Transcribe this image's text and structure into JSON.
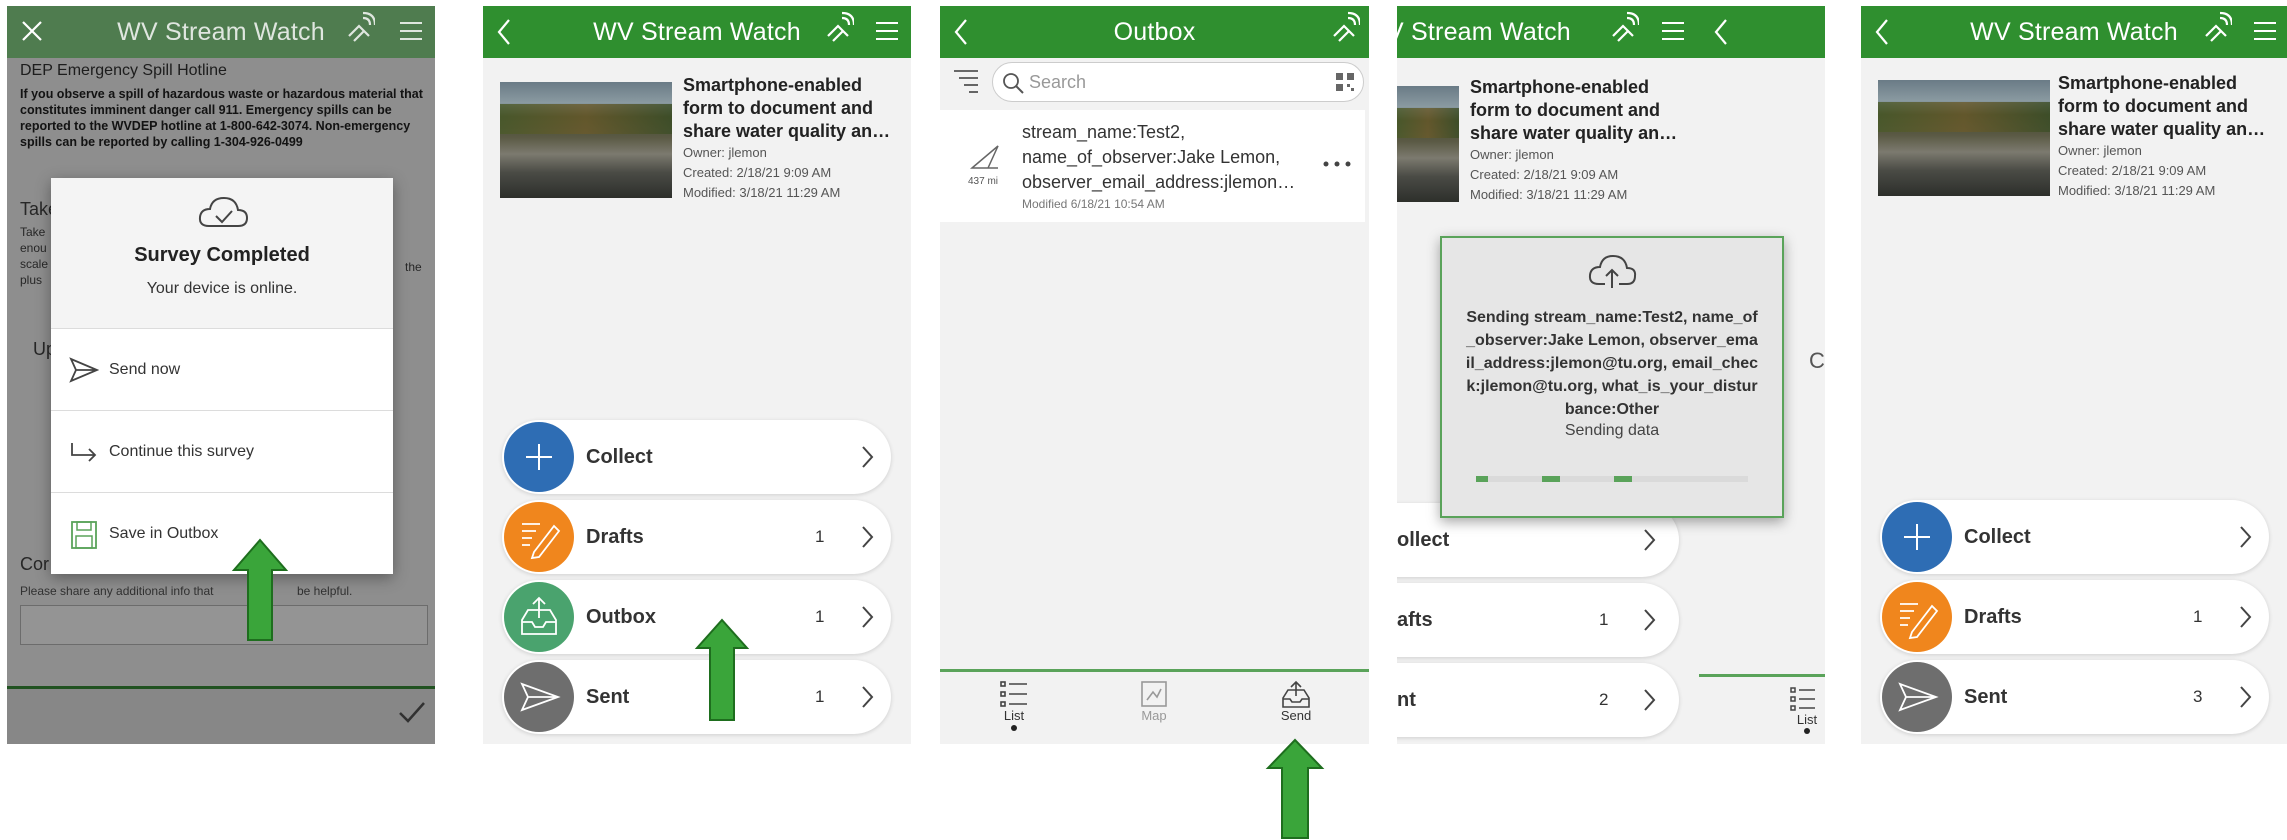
{
  "panel1": {
    "title": "WV Stream Watch",
    "section_heading": "DEP Emergency Spill Hotline",
    "hotline_text": "If you observe a spill of hazardous waste or hazardous material that constitutes imminent danger call 911. Emergency spills can be reported to the WVDEP hotline at 1-800-642-3074. Non-emergency spills can be reported by calling 1-304-926-0499",
    "partial_take": "Take",
    "partial_lines": [
      "Take",
      "enou",
      "scale",
      "plus"
    ],
    "partial_the": "the",
    "partial_up": "Up",
    "partial_comments": "Cor",
    "comments_hint": "Please share any additional info that",
    "comments_hint_tail": "be helpful.",
    "dialog": {
      "title": "Survey Completed",
      "subtitle": "Your device is online.",
      "options": [
        "Send now",
        "Continue this survey",
        "Save in Outbox"
      ]
    }
  },
  "panel2": {
    "title": "WV Stream Watch",
    "form_title": "Smartphone-enabled form to document and share water quality an…",
    "owner": "Owner: jlemon",
    "created": "Created: 2/18/21 9:09 AM",
    "modified": "Modified: 3/18/21 11:29 AM",
    "menu": [
      {
        "label": "Collect",
        "count": "",
        "color": "#2e6db4"
      },
      {
        "label": "Drafts",
        "count": "1",
        "color": "#f0861d"
      },
      {
        "label": "Outbox",
        "count": "1",
        "color": "#4aa36e"
      },
      {
        "label": "Sent",
        "count": "1",
        "color": "#6e6e6e"
      }
    ]
  },
  "panel3": {
    "title": "Outbox",
    "search_placeholder": "Search",
    "item": {
      "line1": "stream_name:Test2,",
      "line2": "name_of_observer:Jake Lemon,",
      "line3": "observer_email_address:jlemon…",
      "modified": "Modified 6/18/21 10:54 AM",
      "distance": "437 mi"
    },
    "tabs": [
      "List",
      "Map",
      "Send"
    ]
  },
  "panel4": {
    "title": "V Stream Watch",
    "form_title": "Smartphone-enabled form to document and share water quality an…",
    "owner": "Owner: jlemon",
    "created": "Created: 2/18/21 9:09 AM",
    "modified": "Modified: 3/18/21 11:29 AM",
    "sending_text": "Sending stream_name:Test2, name_of_observer:Jake Lemon, observer_email_address:jlemon@tu.org, email_check:jlemon@tu.org, what_is_your_disturbance:Other",
    "sending_status": "Sending data",
    "menu": [
      {
        "label": "ollect",
        "count": ""
      },
      {
        "label": "afts",
        "count": "1"
      },
      {
        "label": "nt",
        "count": "2"
      }
    ],
    "side_char": "C",
    "side_tab": "List"
  },
  "panel5": {
    "title": "WV Stream Watch",
    "form_title": "Smartphone-enabled form to document and share water quality an…",
    "owner": "Owner: jlemon",
    "created": "Created: 2/18/21 9:09 AM",
    "modified": "Modified: 3/18/21 11:29 AM",
    "menu": [
      {
        "label": "Collect",
        "count": "",
        "color": "#2e6db4"
      },
      {
        "label": "Drafts",
        "count": "1",
        "color": "#f0861d"
      },
      {
        "label": "Sent",
        "count": "3",
        "color": "#6e6e6e"
      }
    ]
  },
  "colors": {
    "header": "#2f8f2f",
    "arrow": "#3aa53a",
    "arrow_border": "#1e6e1e"
  }
}
